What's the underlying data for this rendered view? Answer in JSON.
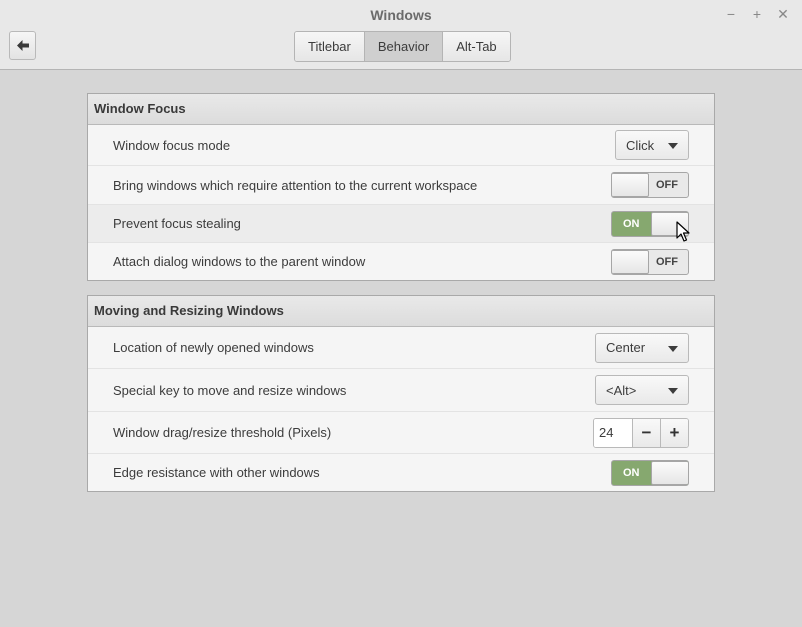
{
  "window": {
    "title": "Windows"
  },
  "wm_buttons": {
    "minimize": "−",
    "maximize": "+",
    "close": "✕"
  },
  "tabs": [
    {
      "label": "Titlebar",
      "active": false
    },
    {
      "label": "Behavior",
      "active": true
    },
    {
      "label": "Alt-Tab",
      "active": false
    }
  ],
  "window_focus": {
    "title": "Window Focus",
    "focus_mode": {
      "label": "Window focus mode",
      "value": "Click"
    },
    "attention": {
      "label": "Bring windows which require attention to the current workspace",
      "state": "OFF"
    },
    "prevent_stealing": {
      "label": "Prevent focus stealing",
      "state": "ON"
    },
    "attach_dialogs": {
      "label": "Attach dialog windows to the parent window",
      "state": "OFF"
    }
  },
  "moving_resizing": {
    "title": "Moving and Resizing Windows",
    "location": {
      "label": "Location of newly opened windows",
      "value": "Center"
    },
    "special_key": {
      "label": "Special key to move and resize windows",
      "value": "<Alt>"
    },
    "threshold": {
      "label": "Window drag/resize threshold (Pixels)",
      "value": "24",
      "minus": "−",
      "plus": "+"
    },
    "edge_resistance": {
      "label": "Edge resistance with other windows",
      "state": "ON"
    }
  },
  "icons": {
    "back": "back-arrow-icon",
    "cursor": "mouse-pointer-icon",
    "dropdown": "dropdown-arrow-icon"
  }
}
